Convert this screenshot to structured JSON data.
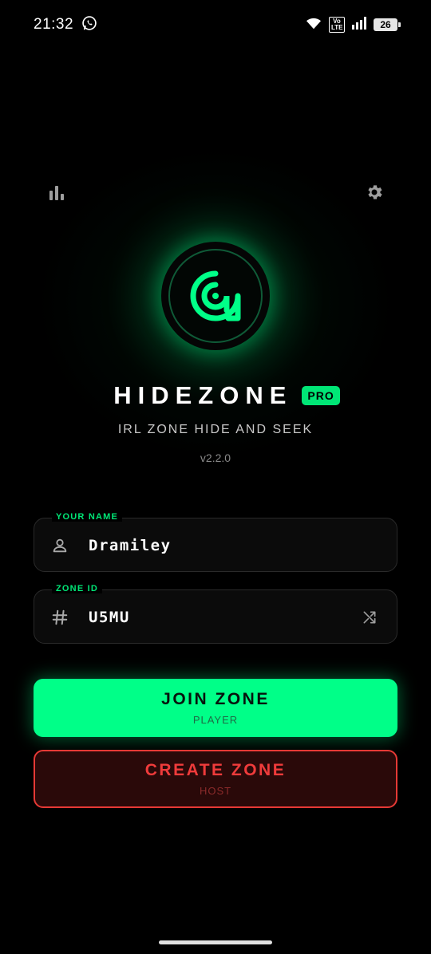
{
  "status_bar": {
    "time": "21:32",
    "battery": "26",
    "network_badge": "Vo\nLTE",
    "icons": [
      "whatsapp-icon",
      "wifi-icon",
      "volte-icon",
      "signal-icon",
      "battery-icon"
    ]
  },
  "toolbar": {
    "stats_icon": "bar-chart-icon",
    "settings_icon": "gear-icon"
  },
  "app": {
    "title": "HIDEZONE",
    "badge": "PRO",
    "subtitle": "IRL ZONE HIDE AND SEEK",
    "version": "v2.2.0"
  },
  "form": {
    "name": {
      "label": "YOUR NAME",
      "value": "Dramiley",
      "icon": "person-icon"
    },
    "zone_id": {
      "label": "ZONE ID",
      "value": "U5MU",
      "icon": "hash-icon",
      "action_icon": "shuffle-icon"
    }
  },
  "actions": {
    "join": {
      "title": "JOIN ZONE",
      "sub": "PLAYER"
    },
    "create": {
      "title": "CREATE ZONE",
      "sub": "HOST"
    }
  },
  "colors": {
    "accent": "#00ff88",
    "accent_label": "#00e676",
    "danger": "#e53935",
    "background": "#000000"
  }
}
